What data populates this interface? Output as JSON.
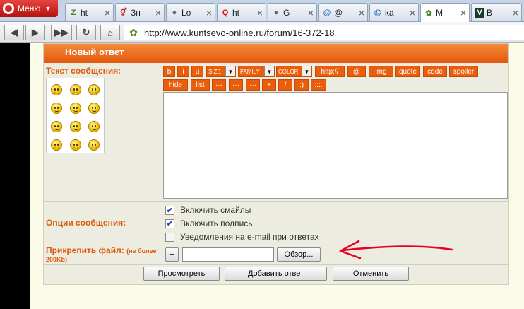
{
  "browser": {
    "menu_label": "Меню",
    "tabs": [
      {
        "label": "ht",
        "fav": "Z"
      },
      {
        "label": "Зн",
        "fav": "⚥"
      },
      {
        "label": "Lo",
        "fav": "●"
      },
      {
        "label": "ht",
        "fav": "Q"
      },
      {
        "label": "G",
        "fav": "●"
      },
      {
        "label": "@",
        "fav": "@"
      },
      {
        "label": "ka",
        "fav": "@"
      },
      {
        "label": "М",
        "fav": "✿"
      },
      {
        "label": "В",
        "fav": "V"
      }
    ],
    "url": "http://www.kuntsevo-online.ru/forum/16-372-18"
  },
  "form": {
    "header": "Новый ответ",
    "message_label": "Текст сообщения:",
    "toolbar_row1": [
      "b",
      "i",
      "u"
    ],
    "selects": [
      "SIZE",
      "FAMILY",
      "COLOR"
    ],
    "toolbar_row1b": [
      "http://",
      "@",
      "img",
      "quote",
      "code",
      "spoiler"
    ],
    "toolbar_row2": [
      "hide",
      "list",
      "···",
      "···",
      "···",
      "+",
      "/",
      ":)",
      ":::."
    ],
    "options_label": "Опции сообщения:",
    "options": [
      {
        "label": "Включить смайлы",
        "checked": true
      },
      {
        "label": "Включить подпись",
        "checked": true
      },
      {
        "label": "Уведомления на e-mail при ответах",
        "checked": false
      }
    ],
    "attach_label": "Прикрепить файл:",
    "attach_note": "(не более 200Kb)",
    "plus_label": "+",
    "browse_label": "Обзор...",
    "preview_label": "Просмотреть",
    "submit_label": "Добавить ответ",
    "cancel_label": "Отменить"
  },
  "colors": {
    "accent": "#e95d0b",
    "header": "#f0711f",
    "label": "#e05a08",
    "annotation_arrow": "#e8001c"
  }
}
